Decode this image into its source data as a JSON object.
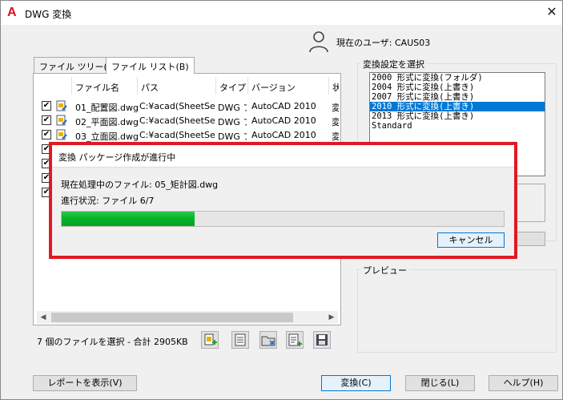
{
  "window": {
    "title": "DWG 変換",
    "close_glyph": "✕"
  },
  "app_icon_letter": "A",
  "user": {
    "label": "現在のユーザ: CAUS03"
  },
  "tabs": [
    {
      "label": "ファイル ツリー(F)"
    },
    {
      "label": "ファイル リスト(B)"
    }
  ],
  "file_table": {
    "columns": [
      "ファイル名",
      "パス",
      "タイプ",
      "バージョン",
      "状"
    ],
    "rows": [
      {
        "checked": true,
        "name": "01_配置図.dwg",
        "path": "C:¥acad(SheetSet)¥",
        "type": "DWG ファ",
        "version": "AutoCAD 2010",
        "status": "変"
      },
      {
        "checked": true,
        "name": "02_平面図.dwg",
        "path": "C:¥acad(SheetSet)¥",
        "type": "DWG ファ",
        "version": "AutoCAD 2010",
        "status": "変"
      },
      {
        "checked": true,
        "name": "03_立面図.dwg",
        "path": "C:¥acad(SheetSet)¥",
        "type": "DWG ファ",
        "version": "AutoCAD 2010",
        "status": "変"
      },
      {
        "checked": true,
        "name": "",
        "path": "",
        "type": "",
        "version": "",
        "status": ""
      },
      {
        "checked": true,
        "name": "",
        "path": "",
        "type": "",
        "version": "",
        "status": ""
      },
      {
        "checked": true,
        "name": "",
        "path": "",
        "type": "",
        "version": "",
        "status": ""
      },
      {
        "checked": true,
        "name": "",
        "path": "",
        "type": "",
        "version": "",
        "status": ""
      }
    ]
  },
  "status_text": "7 個のファイルを選択 - 合計 2905KB",
  "conversion_group": {
    "label": "変換設定を選択",
    "options": [
      "2000 形式に変換(フォルダ)",
      "2004 形式に変換(上書き)",
      "2007 形式に変換(上書き)",
      "2010 形式に変換(上書き)",
      "2013 形式に変換(上書き)",
      "Standard"
    ],
    "selected_index": 3
  },
  "preview_group": {
    "label": "プレビュー"
  },
  "buttons": {
    "report": "レポートを表示(V)",
    "convert": "変換(C)",
    "close": "閉じる(L)",
    "help": "ヘルプ(H)"
  },
  "progress_dialog": {
    "title": "変換 パッケージ作成が進行中",
    "current_file": "現在処理中のファイル: 05_矩計図.dwg",
    "progress_text": "進行状況: ファイル 6/7",
    "progress_fraction": 0.3,
    "cancel_label": "キャンセル"
  },
  "colors": {
    "highlight": "#e01a22",
    "selection": "#0078d7",
    "progress": "#06b025",
    "app_icon": "#d4161d"
  }
}
